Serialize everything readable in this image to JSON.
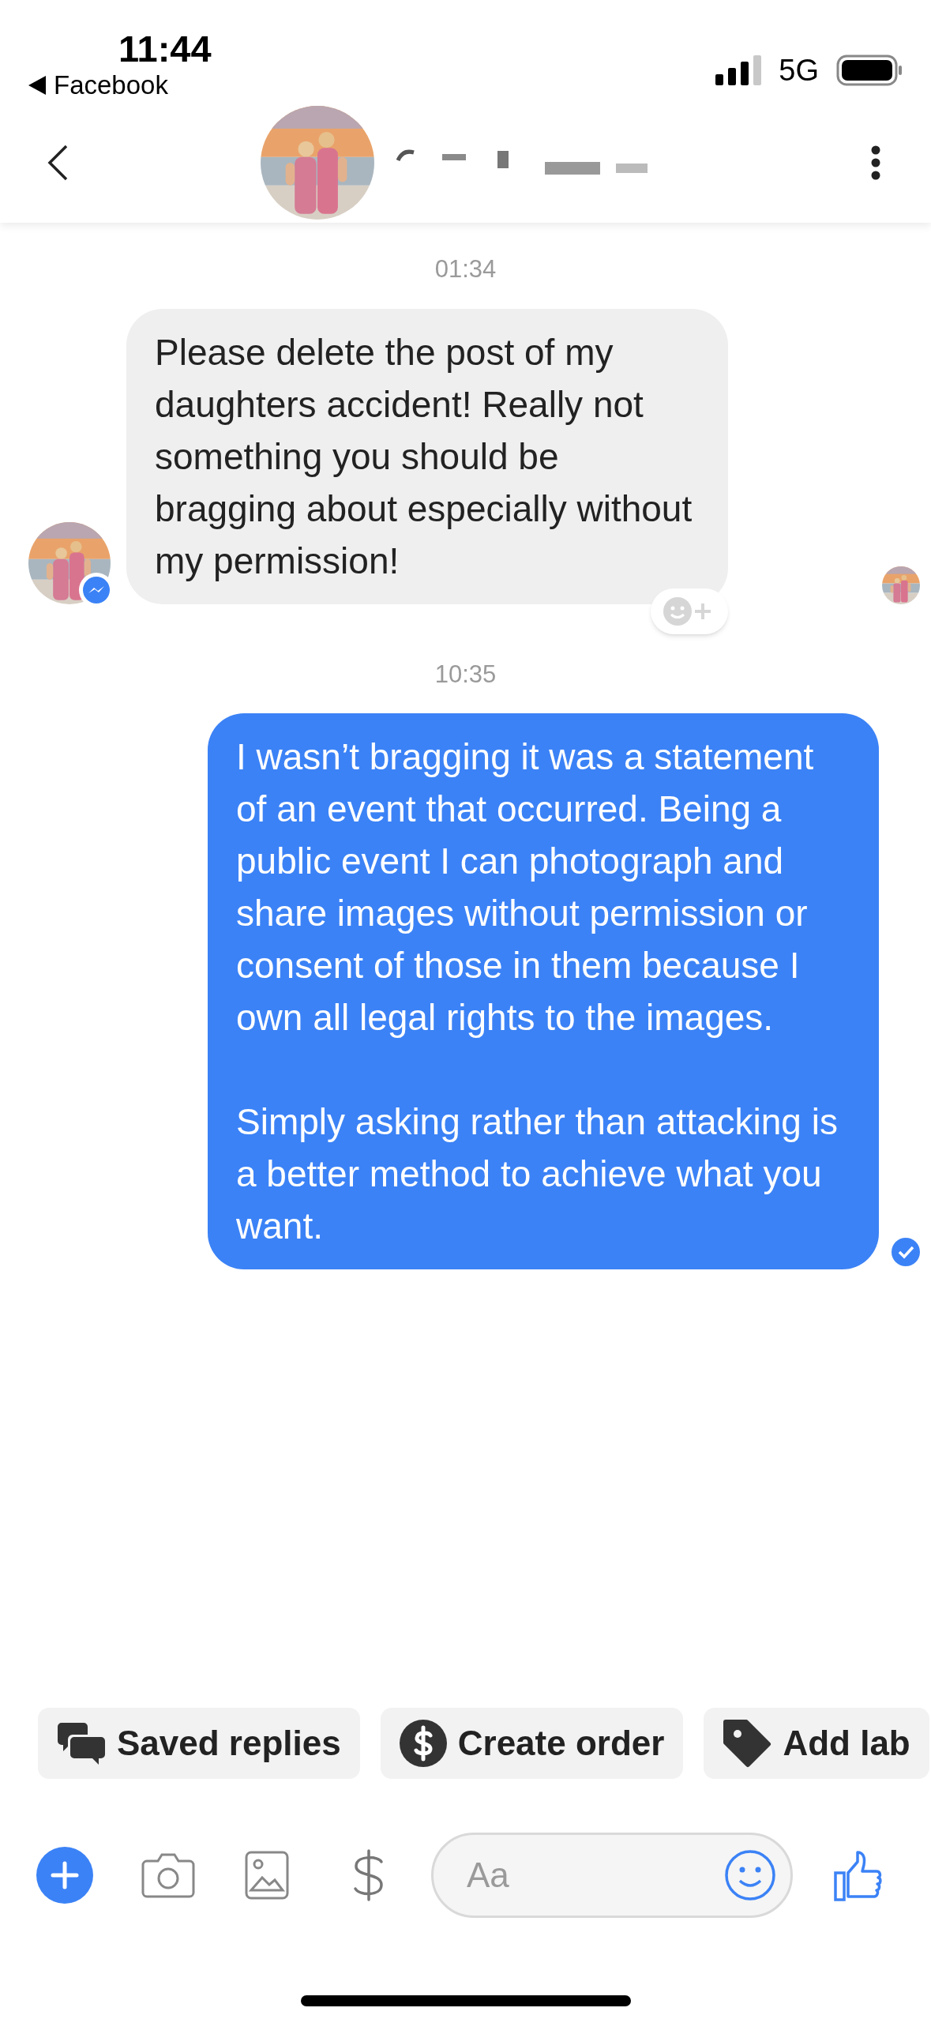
{
  "status_bar": {
    "time": "11:44",
    "back_app": "Facebook",
    "network": "5G"
  },
  "messages": [
    {
      "kind": "timestamp",
      "text": "01:34"
    },
    {
      "kind": "incoming",
      "paragraphs": [
        "Please delete the post of my daughters accident! Really not something you should be bragging about especially without my permission!"
      ]
    },
    {
      "kind": "timestamp",
      "text": "10:35"
    },
    {
      "kind": "outgoing",
      "paragraphs": [
        "I wasn’t bragging it was a statement of an event that occurred. Being a public event I can photograph and share images without permission or consent of those in them because I own all legal rights to the images.",
        "Simply asking rather than attacking is a better method to achieve what you want."
      ]
    }
  ],
  "quick_replies": [
    {
      "kind": "saved",
      "label": "Saved replies"
    },
    {
      "kind": "order",
      "label": "Create order"
    },
    {
      "kind": "tag",
      "label": "Add lab"
    }
  ],
  "composer": {
    "placeholder": "Aa"
  }
}
